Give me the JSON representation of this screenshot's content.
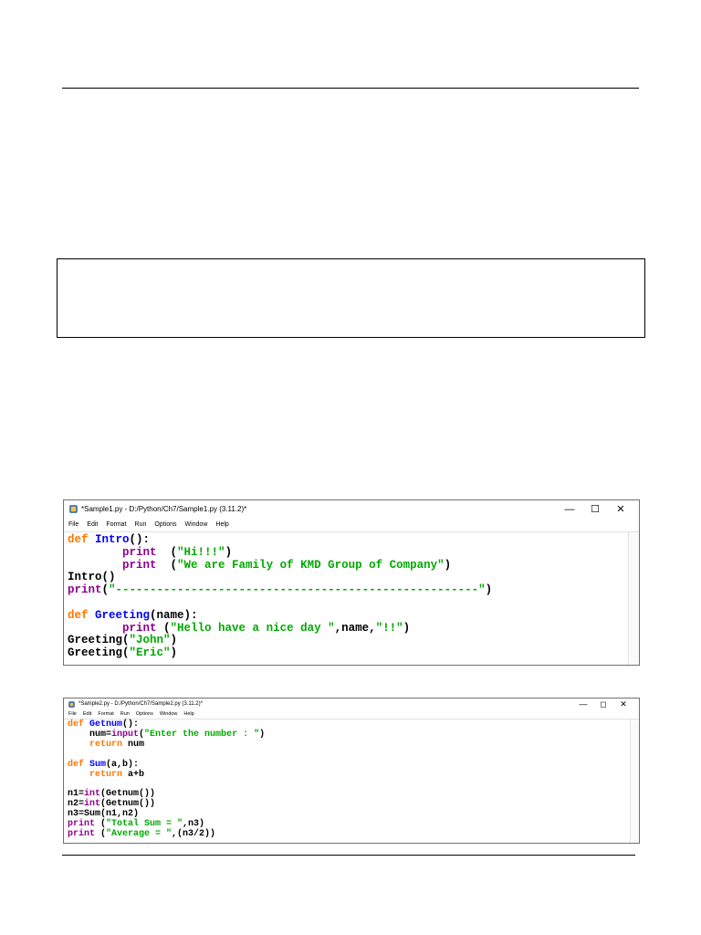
{
  "window1": {
    "title": "*Sample1.py - D:/Python/Ch7/Sample1.py (3.11.2)*",
    "controls": {
      "minimize": "—",
      "maximize": "☐",
      "close": "✕"
    },
    "menu": [
      "File",
      "Edit",
      "Format",
      "Run",
      "Options",
      "Window",
      "Help"
    ],
    "code_lines": [
      [
        {
          "t": "def ",
          "c": "kw"
        },
        {
          "t": "Intro",
          "c": "fn"
        },
        {
          "t": "():",
          "c": "plain"
        }
      ],
      [
        {
          "t": "        ",
          "c": "plain"
        },
        {
          "t": "print",
          "c": "bi"
        },
        {
          "t": "  (",
          "c": "plain"
        },
        {
          "t": "\"Hi!!!\"",
          "c": "st"
        },
        {
          "t": ")",
          "c": "plain"
        }
      ],
      [
        {
          "t": "        ",
          "c": "plain"
        },
        {
          "t": "print",
          "c": "bi"
        },
        {
          "t": "  (",
          "c": "plain"
        },
        {
          "t": "\"We are Family of KMD Group of Company\"",
          "c": "st"
        },
        {
          "t": ")",
          "c": "plain"
        }
      ],
      [
        {
          "t": "Intro()",
          "c": "plain"
        }
      ],
      [
        {
          "t": "print",
          "c": "bi"
        },
        {
          "t": "(",
          "c": "plain"
        },
        {
          "t": "\"-----------------------------------------------------\"",
          "c": "st"
        },
        {
          "t": ")",
          "c": "plain"
        }
      ],
      [
        {
          "t": "",
          "c": "plain"
        }
      ],
      [
        {
          "t": "def ",
          "c": "kw"
        },
        {
          "t": "Greeting",
          "c": "fn"
        },
        {
          "t": "(name):",
          "c": "plain"
        }
      ],
      [
        {
          "t": "        ",
          "c": "plain"
        },
        {
          "t": "print",
          "c": "bi"
        },
        {
          "t": " (",
          "c": "plain"
        },
        {
          "t": "\"Hello have a nice day \"",
          "c": "st"
        },
        {
          "t": ",name,",
          "c": "plain"
        },
        {
          "t": "\"!!\"",
          "c": "st"
        },
        {
          "t": ")",
          "c": "plain"
        }
      ],
      [
        {
          "t": "Greeting(",
          "c": "plain"
        },
        {
          "t": "\"John\"",
          "c": "st"
        },
        {
          "t": ")",
          "c": "plain"
        }
      ],
      [
        {
          "t": "Greeting(",
          "c": "plain"
        },
        {
          "t": "\"Eric\"",
          "c": "st"
        },
        {
          "t": ")",
          "c": "plain"
        }
      ]
    ]
  },
  "window2": {
    "title": "*Sample2.py - D:/Python/Ch7/Sample2.py (3.11.2)*",
    "controls": {
      "minimize": "—",
      "maximize": "◻",
      "close": "✕"
    },
    "menu": [
      "File",
      "Edit",
      "Format",
      "Run",
      "Options",
      "Window",
      "Help"
    ],
    "code_lines": [
      [
        {
          "t": "def ",
          "c": "kw"
        },
        {
          "t": "Getnum",
          "c": "fn"
        },
        {
          "t": "():",
          "c": "plain"
        }
      ],
      [
        {
          "t": "    num=",
          "c": "plain"
        },
        {
          "t": "input",
          "c": "bi"
        },
        {
          "t": "(",
          "c": "plain"
        },
        {
          "t": "\"Enter the number : \"",
          "c": "st"
        },
        {
          "t": ")",
          "c": "plain"
        }
      ],
      [
        {
          "t": "    ",
          "c": "plain"
        },
        {
          "t": "return",
          "c": "kw"
        },
        {
          "t": " num",
          "c": "plain"
        }
      ],
      [
        {
          "t": "",
          "c": "plain"
        }
      ],
      [
        {
          "t": "def ",
          "c": "kw"
        },
        {
          "t": "Sum",
          "c": "fn"
        },
        {
          "t": "(a,b):",
          "c": "plain"
        }
      ],
      [
        {
          "t": "    ",
          "c": "plain"
        },
        {
          "t": "return",
          "c": "kw"
        },
        {
          "t": " a+b",
          "c": "plain"
        }
      ],
      [
        {
          "t": "",
          "c": "plain"
        }
      ],
      [
        {
          "t": "n1=",
          "c": "plain"
        },
        {
          "t": "int",
          "c": "bi"
        },
        {
          "t": "(Getnum())",
          "c": "plain"
        }
      ],
      [
        {
          "t": "n2=",
          "c": "plain"
        },
        {
          "t": "int",
          "c": "bi"
        },
        {
          "t": "(Getnum())",
          "c": "plain"
        }
      ],
      [
        {
          "t": "n3=Sum(n1,n2)",
          "c": "plain"
        }
      ],
      [
        {
          "t": "print",
          "c": "bi"
        },
        {
          "t": " (",
          "c": "plain"
        },
        {
          "t": "\"Total Sum = \"",
          "c": "st"
        },
        {
          "t": ",n3)",
          "c": "plain"
        }
      ],
      [
        {
          "t": "print",
          "c": "bi"
        },
        {
          "t": " (",
          "c": "plain"
        },
        {
          "t": "\"Average = \"",
          "c": "st"
        },
        {
          "t": ",(n3/2))",
          "c": "plain"
        }
      ]
    ]
  },
  "colors": {
    "keyword": "#ff7700",
    "function_name": "#0000ff",
    "builtin": "#900090",
    "string": "#00aa00",
    "default": "#000000"
  },
  "icons": {
    "app": "idle-python-icon"
  }
}
